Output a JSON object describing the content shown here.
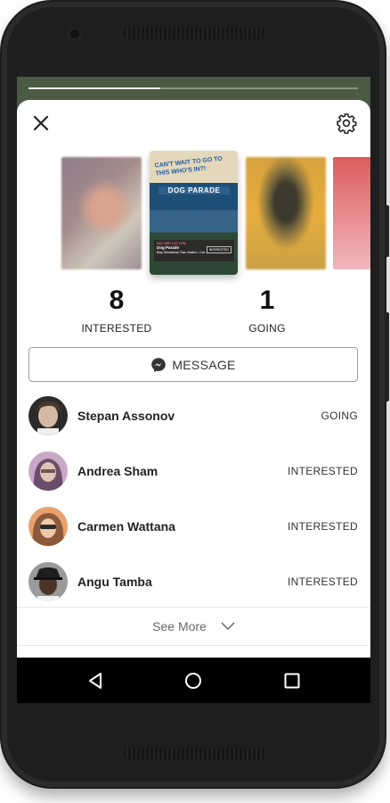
{
  "event": {
    "interested_count": "8",
    "interested_label": "INTERESTED",
    "going_count": "1",
    "going_label": "GOING",
    "message_label": "MESSAGE"
  },
  "poster": {
    "headline": "CAN'T WAIT TO GO TO THIS WHO'S IN?!",
    "title": "DOG PARADE",
    "card_date": "SAT, SEP 1 AT 4 PM",
    "card_name": "Dog Parade",
    "card_location": "Bay Meadows San Mateo, Cal...",
    "card_button": "INTERESTED"
  },
  "attendees": [
    {
      "name": "Stepan Assonov",
      "status": "GOING"
    },
    {
      "name": "Andrea Sham",
      "status": "INTERESTED"
    },
    {
      "name": "Carmen Wattana",
      "status": "INTERESTED"
    },
    {
      "name": "Angu Tamba",
      "status": "INTERESTED"
    }
  ],
  "see_more_label": "See More",
  "story_progress": 0.4,
  "colors": {
    "sheet_bg": "#ffffff",
    "backdrop": "#4a5a43",
    "messenger_blue": "#333333"
  },
  "icons": {
    "close": "close-icon",
    "settings": "gear-icon",
    "messenger": "messenger-icon",
    "chevron": "chevron-down-icon",
    "back": "back-icon",
    "home": "home-icon",
    "recents": "recents-icon"
  }
}
